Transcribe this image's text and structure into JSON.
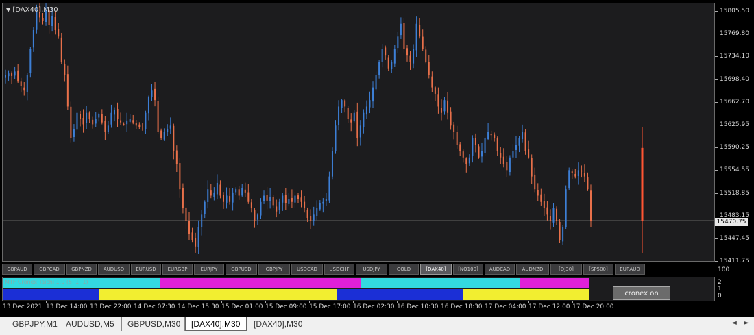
{
  "chart": {
    "title": "[DAX40],M30",
    "title_icon": "triangle-down-icon",
    "price_ticks": [
      "15805.50",
      "15769.80",
      "15734.10",
      "15698.40",
      "15662.70",
      "15625.95",
      "15590.25",
      "15554.55",
      "15518.85",
      "15483.15",
      "15447.45",
      "15411.75"
    ],
    "current_price": "15470.75",
    "colors": {
      "bull": "#3d7fd6",
      "bear": "#e8704a",
      "last_bar": "#ff5533",
      "background": "#1c1c1e"
    }
  },
  "chart_data": {
    "type": "candlestick",
    "symbol": "[DAX40]",
    "timeframe": "M30",
    "ylim": [
      15405,
      15812
    ],
    "series": [
      {
        "name": "close",
        "values": [
          15700,
          15702,
          15698,
          15705,
          15690,
          15682,
          15675,
          15700,
          15740,
          15770,
          15800,
          15790,
          15785,
          15802,
          15778,
          15792,
          15770,
          15760,
          15720,
          15700,
          15650,
          15600,
          15615,
          15640,
          15630,
          15622,
          15640,
          15630,
          15622,
          15630,
          15638,
          15625,
          15610,
          15620,
          15640,
          15645,
          15630,
          15625,
          15622,
          15628,
          15630,
          15625,
          15620,
          15618,
          15615,
          15640,
          15665,
          15675,
          15660,
          15610,
          15600,
          15610,
          15615,
          15620,
          15580,
          15560,
          15520,
          15490,
          15470,
          15450,
          15440,
          15430,
          15460,
          15480,
          15500,
          15520,
          15510,
          15515,
          15530,
          15510,
          15500,
          15510,
          15500,
          15515,
          15520,
          15510,
          15522,
          15515,
          15500,
          15490,
          15470,
          15480,
          15500,
          15510,
          15502,
          15508,
          15495,
          15485,
          15500,
          15510,
          15498,
          15505,
          15500,
          15510,
          15505,
          15500,
          15490,
          15475,
          15470,
          15480,
          15490,
          15498,
          15500,
          15505,
          15540,
          15580,
          15620,
          15650,
          15660,
          15650,
          15630,
          15625,
          15640,
          15600,
          15620,
          15640,
          15650,
          15660,
          15680,
          15700,
          15720,
          15740,
          15730,
          15710,
          15720,
          15740,
          15760,
          15780,
          15740,
          15730,
          15720,
          15740,
          15780,
          15760,
          15740,
          15720,
          15700,
          15680,
          15670,
          15650,
          15640,
          15660,
          15640,
          15620,
          15610,
          15590,
          15580,
          15570,
          15560,
          15570,
          15600,
          15590,
          15570,
          15580,
          15600,
          15610,
          15605,
          15600,
          15580,
          15570,
          15560,
          15550,
          15570,
          15580,
          15590,
          15600,
          15610,
          15580,
          15570,
          15540,
          15520,
          15510,
          15500,
          15490,
          15480,
          15470,
          15490,
          15470,
          15440,
          15460,
          15520,
          15550,
          15545,
          15540,
          15550,
          15548,
          15540,
          15520,
          15470
        ]
      },
      {
        "name": "last",
        "values": [
          15470.75
        ]
      }
    ],
    "x_tick_labels": [
      "13 Dec 2021",
      "13 Dec 14:00",
      "13 Dec 22:00",
      "14 Dec 07:30",
      "14 Dec 15:30",
      "15 Dec 01:00",
      "15 Dec 09:00",
      "15 Dec 17:00",
      "16 Dec 02:30",
      "16 Dec 10:30",
      "16 Dec 18:30",
      "17 Dec 04:00",
      "17 Dec 12:00",
      "17 Dec 20:00"
    ]
  },
  "symbol_bar": {
    "buttons": [
      "GBPAUD",
      "GBPCAD",
      "GBPNZD",
      "AUDUSD",
      "EURUSD",
      "EURGBP",
      "EURJPY",
      "GBPUSD",
      "GBPJPY",
      "USDCAD",
      "USDCHF",
      "USDJPY",
      "GOLD",
      "[DAX40]",
      "[NQ100]",
      "AUDCAD",
      "AUDNZD",
      "[DJ30]",
      "[SP500]",
      "EURAUD"
    ],
    "active": "[DAX40]"
  },
  "indicator": {
    "label": "MTF Cronex Taichi 1.0 (5, 1, 1)",
    "button_label": "cronex on",
    "scale_ticks": [
      "100",
      "2",
      "1",
      "0"
    ],
    "top_band": [
      {
        "color": "#33d9e0",
        "from": 0,
        "to": 230
      },
      {
        "color": "#e020d8",
        "from": 230,
        "to": 523
      },
      {
        "color": "#33d9e0",
        "from": 523,
        "to": 755
      },
      {
        "color": "#e020d8",
        "from": 755,
        "to": 855
      }
    ],
    "bottom_band": [
      {
        "color": "#1b2fd6",
        "from": 0,
        "to": 140
      },
      {
        "color": "#f2ee30",
        "from": 140,
        "to": 487
      },
      {
        "color": "#1b2fd6",
        "from": 487,
        "to": 672
      },
      {
        "color": "#f2ee30",
        "from": 672,
        "to": 855
      }
    ]
  },
  "tabs": {
    "items": [
      "GBPJPY,M1",
      "AUDUSD,M5",
      "GBPUSD,M30",
      "[DAX40],M30",
      "[DAX40],M30"
    ],
    "active_index": 3,
    "scroll_left": "◄",
    "scroll_right": "►"
  }
}
